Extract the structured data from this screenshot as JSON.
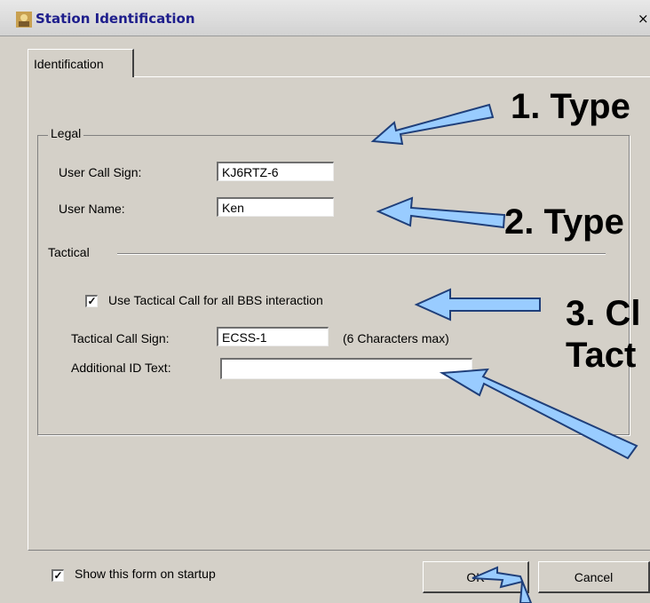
{
  "window": {
    "title": "Station Identification",
    "close_glyph": "×"
  },
  "tabs": [
    {
      "label": "Identification"
    }
  ],
  "legal": {
    "group_label": "Legal",
    "call_sign_label": "User Call Sign:",
    "call_sign_value": "KJ6RTZ-6",
    "name_label": "User Name:",
    "name_value": "Ken"
  },
  "tactical": {
    "group_label": "Tactical",
    "use_tactical_label": "Use Tactical Call for all BBS interaction",
    "use_tactical_checked": true,
    "call_sign_label": "Tactical Call Sign:",
    "call_sign_value": "ECSS-1",
    "call_sign_hint": "(6 Characters max)",
    "additional_id_label": "Additional ID Text:",
    "additional_id_value": ""
  },
  "footer": {
    "show_on_startup_label": "Show this form on startup",
    "show_on_startup_checked": true,
    "ok_label": "OK",
    "cancel_label": "Cancel"
  },
  "annotations": {
    "step1": "1. Type",
    "step2": "2. Type",
    "step3_line1": "3. Cl",
    "step3_line2": "Tact"
  },
  "colors": {
    "arrow_fill": "#99ccff",
    "arrow_stroke": "#1f3f7a",
    "dialog_bg": "#d4d0c8",
    "title_text": "#1e1e8c"
  }
}
